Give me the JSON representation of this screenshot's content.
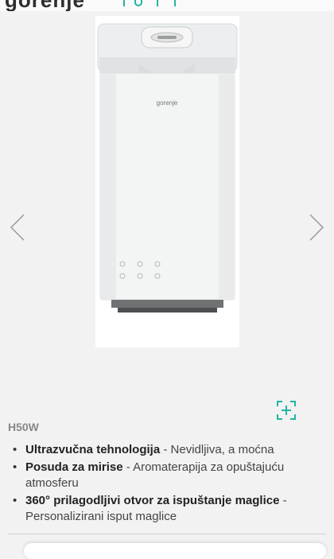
{
  "header": {
    "logo_text": "gorenje"
  },
  "carousel": {
    "product_brand_text": "gorenje",
    "prev_icon": "chevron-left-icon",
    "next_icon": "chevron-right-icon",
    "zoom_icon": "zoom-plus-icon",
    "accent_color": "#1fb5a5"
  },
  "product": {
    "model": "H50W",
    "features": [
      {
        "title": "Ultrazvučna tehnologija",
        "desc": " - Nevidljiva, a moćna"
      },
      {
        "title": "Posuda za mirise",
        "desc": " - Aromaterapija za opuštajuću atmosferu"
      },
      {
        "title": "360° prilagodljivi otvor za ispuštanje maglice",
        "desc": " - Personalizirani isput maglice"
      }
    ]
  }
}
